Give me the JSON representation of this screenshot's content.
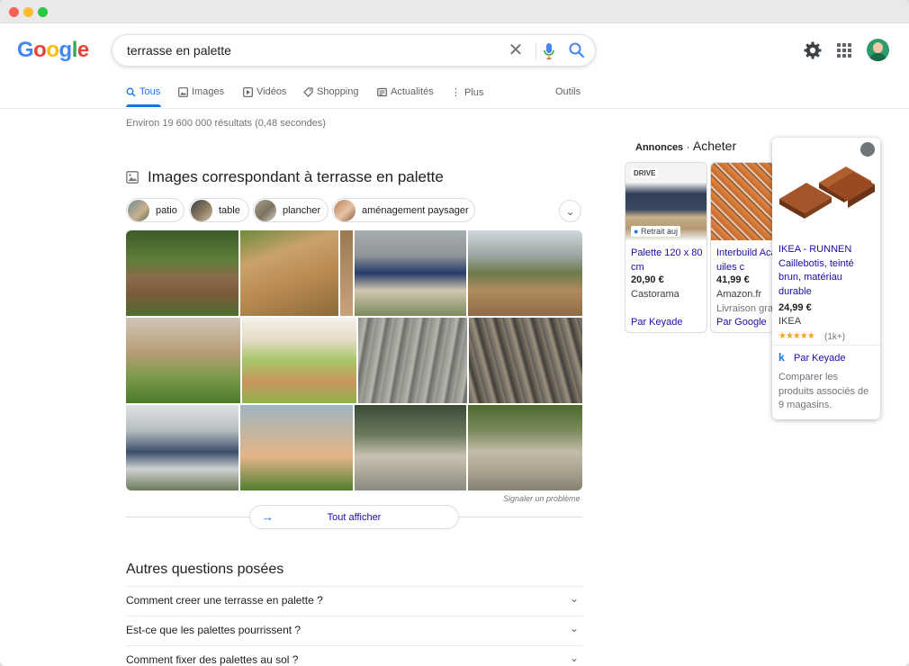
{
  "colors": {
    "brand_blue": "#4285f4",
    "brand_red": "#ea4335",
    "brand_yellow": "#fbbc05",
    "brand_green": "#34a853",
    "link": "#1a0dab",
    "active_tab": "#1a73e8"
  },
  "logo": {
    "letters": [
      "G",
      "o",
      "o",
      "g",
      "l",
      "e"
    ]
  },
  "search": {
    "query": "terrasse en palette"
  },
  "tabs": [
    {
      "label": "Tous",
      "icon": "search-icon",
      "active": true
    },
    {
      "label": "Images",
      "icon": "image-icon"
    },
    {
      "label": "Vidéos",
      "icon": "video-icon"
    },
    {
      "label": "Shopping",
      "icon": "tag-icon"
    },
    {
      "label": "Actualités",
      "icon": "news-icon"
    },
    {
      "label": "Plus",
      "icon": "more-vertical-icon"
    }
  ],
  "tools_label": "Outils",
  "results_stats": "Environ 19 600 000 résultats (0,48 secondes)",
  "images_section": {
    "title": "Images correspondant à terrasse en palette",
    "chips": [
      "patio",
      "table",
      "plancher",
      "aménagement paysager"
    ],
    "report_label": "Signaler un problème",
    "see_all_label": "Tout afficher"
  },
  "paa": {
    "title": "Autres questions posées",
    "questions": [
      "Comment creer une terrasse en palette ?",
      "Est-ce que les palettes pourrissent ?",
      "Comment fixer des palettes au sol ?"
    ]
  },
  "ads": {
    "label": "Annonces",
    "separator": "·",
    "title": "Acheter",
    "products": [
      {
        "badge": "DRIVE",
        "pickup": "Retrait auj",
        "name": "Palette 120 x 80 cm",
        "price": "20,90 €",
        "seller": "Castorama",
        "extra": "",
        "by": "Par Keyade"
      },
      {
        "badge": "",
        "pickup": "",
        "name": "Interbuild Acacia uiles c",
        "price": "41,99 €",
        "seller": "Amazon.fr",
        "extra": "Livraison gra",
        "by": "Par Google"
      }
    ],
    "featured": {
      "name": "IKEA - RUNNEN Caillebotis, teinté brun, matériau durable",
      "price": "24,99 €",
      "seller": "IKEA",
      "stars": "★★★★★",
      "rating_count": "(1k+)",
      "by_letter": "k",
      "by": "Par Keyade",
      "compare": "Comparer les produits associés de 9 magasins."
    }
  }
}
